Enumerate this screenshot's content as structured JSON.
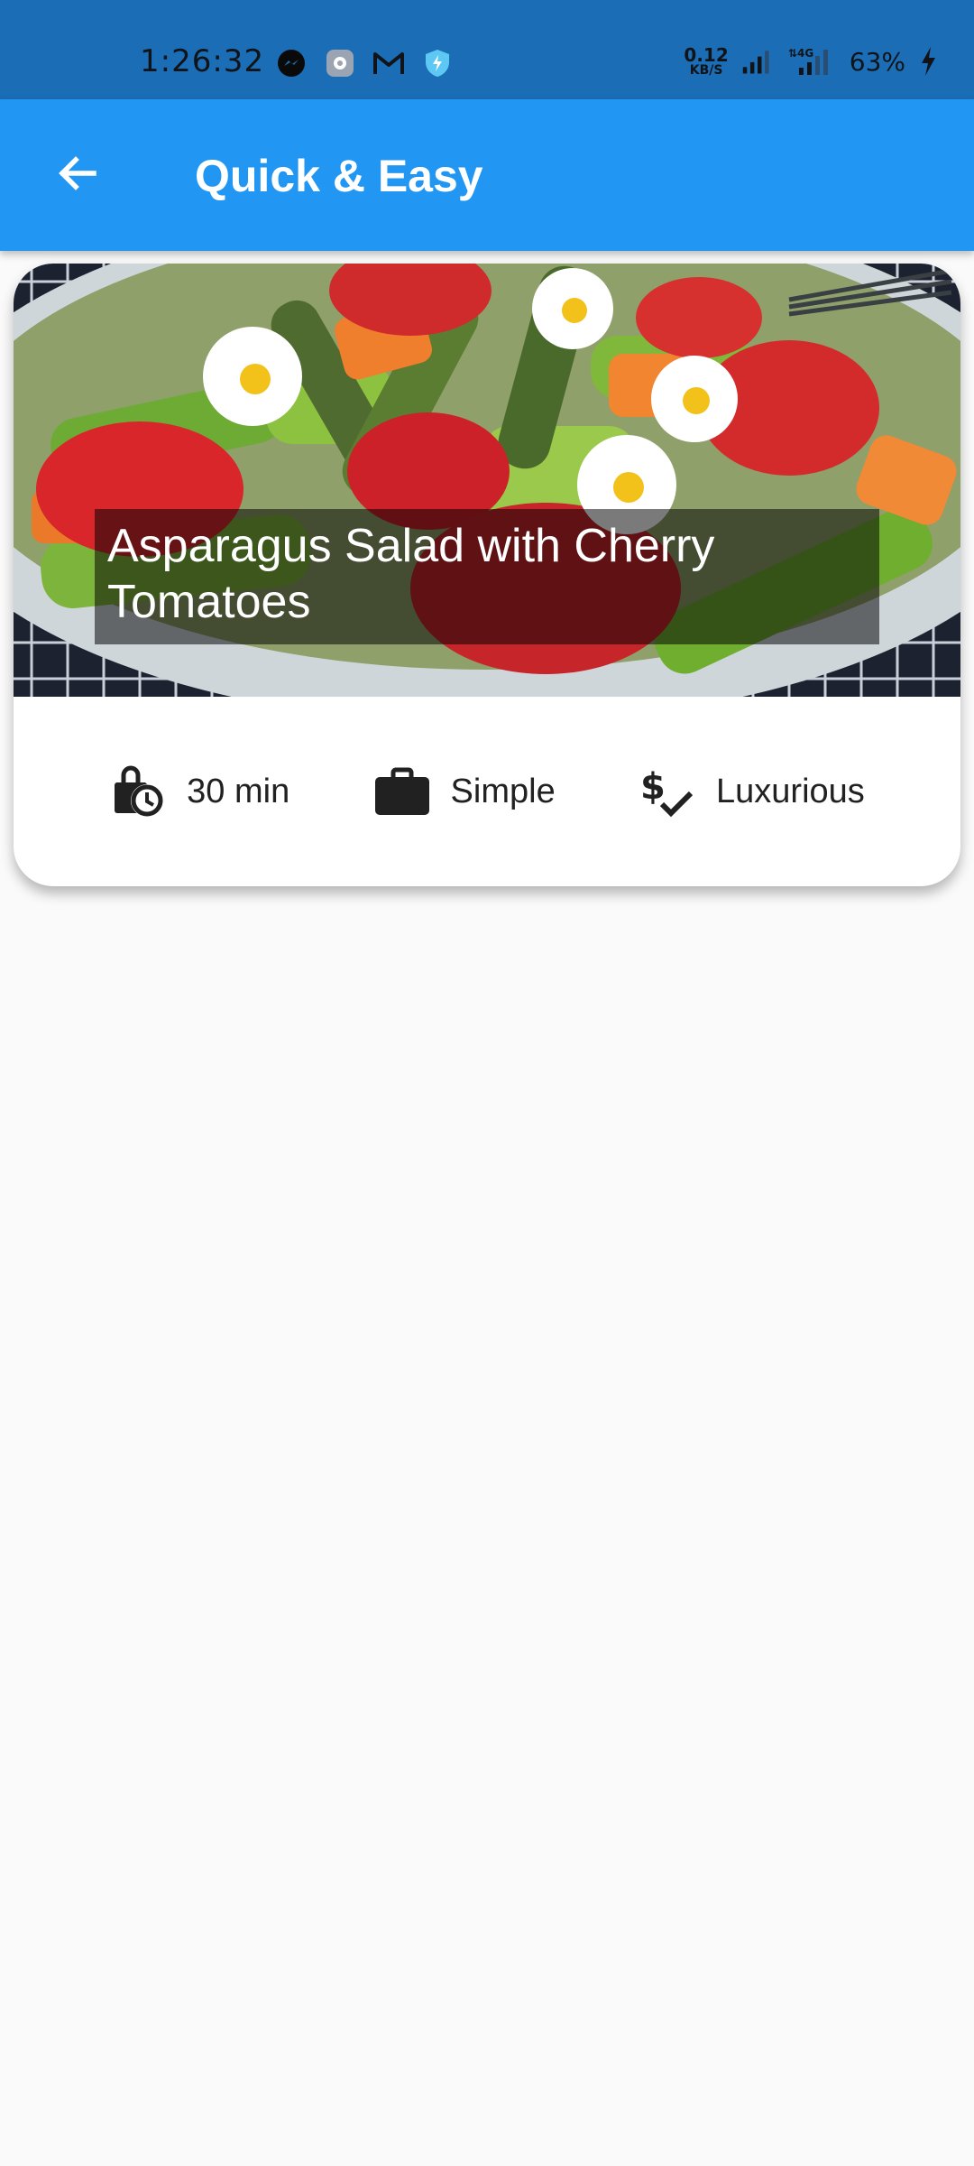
{
  "status_bar": {
    "time": "1:26:32",
    "net_speed_value": "0.12",
    "net_speed_unit": "KB/S",
    "battery": "63%",
    "icons": [
      "messenger-icon",
      "settings-app-icon",
      "gmail-icon",
      "shield-bolt-icon",
      "signal-icon",
      "signal-4g-icon",
      "charging-icon"
    ]
  },
  "app_bar": {
    "title": "Quick & Easy",
    "back_icon": "arrow-back-icon"
  },
  "meal_card": {
    "title": "Asparagus Salad with Cherry Tomatoes",
    "duration": "30 min",
    "complexity": "Simple",
    "affordability": "Luxurious",
    "icons": {
      "duration": "timer-bag-icon",
      "complexity": "work-briefcase-icon",
      "affordability": "price-check-icon"
    }
  },
  "colors": {
    "status_bar": "#1b6db6",
    "app_bar": "#2196f3",
    "background": "#fafafa",
    "card": "#ffffff",
    "text": "#212121"
  }
}
